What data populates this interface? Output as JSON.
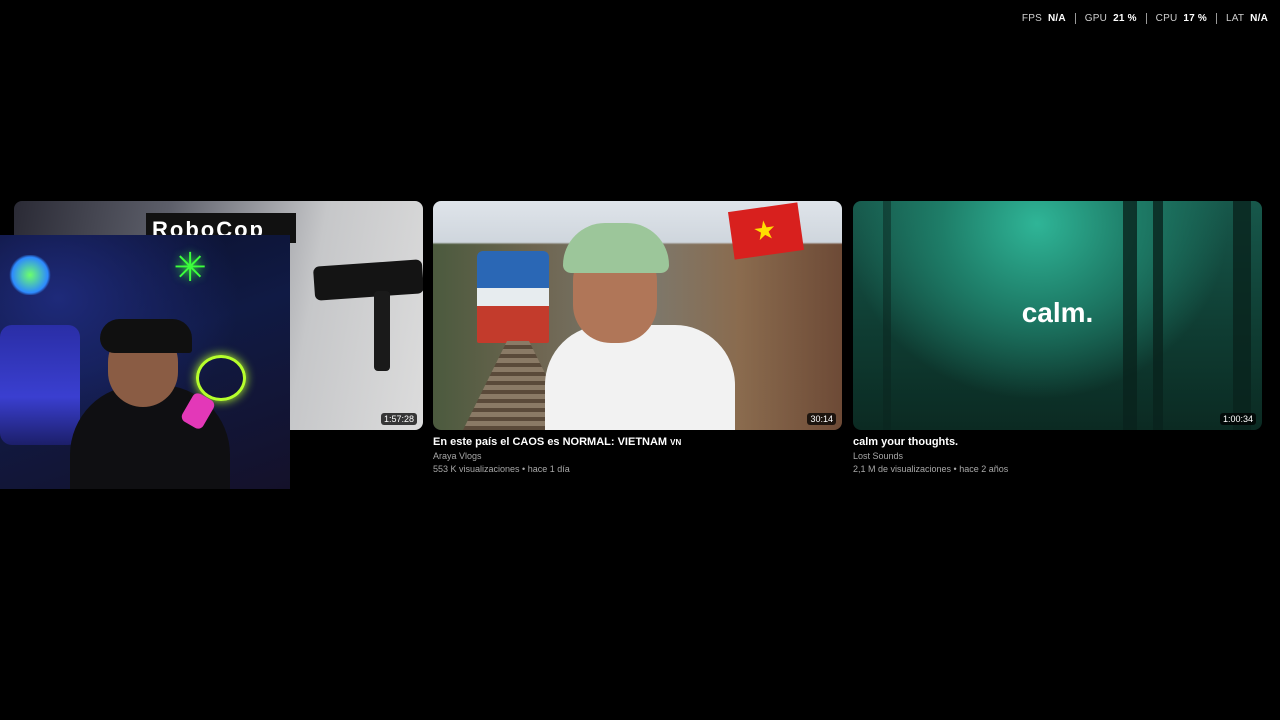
{
  "perf": [
    {
      "label": "FPS",
      "value": "N/A"
    },
    {
      "label": "GPU",
      "value": "21 %"
    },
    {
      "label": "CPU",
      "value": "17 %"
    },
    {
      "label": "LAT",
      "value": "N/A"
    }
  ],
  "videos": [
    {
      "banner": "RoboCop",
      "duration": "1:57:28"
    },
    {
      "title": "En este país el CAOS es NORMAL: VIETNAM",
      "flag": "VN",
      "channel": "Araya Vlogs",
      "meta": "553 K visualizaciones • hace 1 día",
      "duration": "30:14"
    },
    {
      "overlay_text": "calm.",
      "title": "calm your thoughts.",
      "channel": "Lost Sounds",
      "meta": "2,1 M de visualizaciones • hace 2 años",
      "duration": "1:00:34"
    }
  ]
}
